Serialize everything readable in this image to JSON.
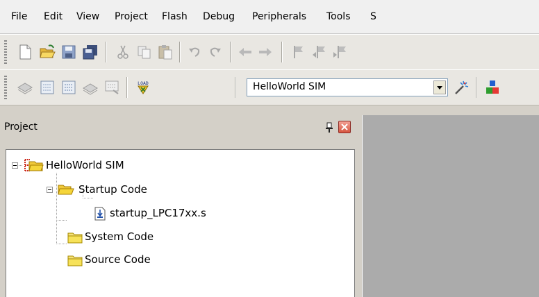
{
  "menu": [
    "File",
    "Edit",
    "View",
    "Project",
    "Flash",
    "Debug",
    "Peripherals",
    "Tools",
    "S"
  ],
  "toolbar1": {
    "icons": [
      "new-file-icon",
      "open-folder-icon",
      "save-icon",
      "save-all-icon",
      "cut-icon",
      "copy-icon",
      "paste-icon",
      "undo-icon",
      "redo-icon",
      "nav-back-icon",
      "nav-forward-icon",
      "bookmark-icon",
      "bookmark-prev-icon",
      "bookmark-next-icon"
    ]
  },
  "toolbar2": {
    "icons": [
      "translate-icon",
      "build-icon",
      "rebuild-icon",
      "batch-build-icon",
      "stop-build-icon",
      "load-icon",
      "target-options-icon",
      "manage-components-icon"
    ],
    "load_text": "LOAD",
    "target_value": "HelloWorld SIM"
  },
  "project_panel": {
    "title": "Project",
    "tree": {
      "root": "HelloWorld SIM",
      "groups": [
        {
          "label": "Startup Code",
          "files": [
            "startup_LPC17xx.s"
          ]
        },
        {
          "label": "System Code",
          "files": []
        },
        {
          "label": "Source Code",
          "files": []
        }
      ]
    }
  },
  "colors": {
    "folder": "#f5d53a",
    "root_tree_icon": "#cc2a1c",
    "editor_bg": "#ababab"
  }
}
